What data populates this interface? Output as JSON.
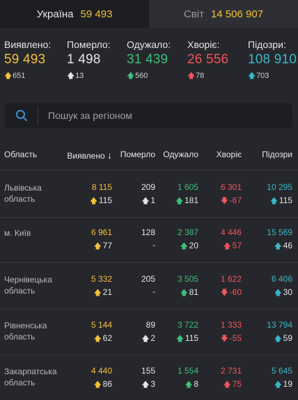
{
  "colors": {
    "confirmed": "#f3c13a",
    "deaths": "#ffffff",
    "recovered": "#3fbf7a",
    "sick": "#f0555d",
    "suspected": "#3ab8c8"
  },
  "tabs": [
    {
      "label": "Україна",
      "count": "59 493"
    },
    {
      "label": "Світ",
      "count": "14 506 907"
    }
  ],
  "summary": {
    "confirmed": {
      "label": "Виявлено:",
      "value": "59 493",
      "delta": "651"
    },
    "deaths": {
      "label": "Померло:",
      "value": "1 498",
      "delta": "13"
    },
    "recovered": {
      "label": "Одужало:",
      "value": "31 439",
      "delta": "560"
    },
    "sick": {
      "label": "Хворіє:",
      "value": "26 556",
      "delta": "78"
    },
    "suspected": {
      "label": "Підозри:",
      "value": "108 910",
      "delta": "703"
    }
  },
  "search": {
    "placeholder": "Пошук за регіоном",
    "icon": "search-icon"
  },
  "table": {
    "headers": {
      "region": "Область",
      "confirmed": "Виявлено",
      "deaths": "Померло",
      "recovered": "Одужало",
      "sick": "Хворіє",
      "suspected": "Підозри"
    },
    "sort_indicator": "↓",
    "rows": [
      {
        "region": "Львівська область",
        "confirmed": "8 115",
        "confirmed_delta": "115",
        "deaths": "209",
        "deaths_delta": "1",
        "recovered": "1 605",
        "recovered_delta": "181",
        "sick": "6 301",
        "sick_delta": "-67",
        "suspected": "10 295",
        "suspected_delta": "115"
      },
      {
        "region": "м. Київ",
        "confirmed": "6 961",
        "confirmed_delta": "77",
        "deaths": "128",
        "deaths_delta": "-",
        "recovered": "2 387",
        "recovered_delta": "20",
        "sick": "4 446",
        "sick_delta": "57",
        "suspected": "15 569",
        "suspected_delta": "46"
      },
      {
        "region": "Чернівецька область",
        "confirmed": "5 332",
        "confirmed_delta": "21",
        "deaths": "205",
        "deaths_delta": "-",
        "recovered": "3 505",
        "recovered_delta": "81",
        "sick": "1 622",
        "sick_delta": "-60",
        "suspected": "6 406",
        "suspected_delta": "30"
      },
      {
        "region": "Рівненська область",
        "confirmed": "5 144",
        "confirmed_delta": "62",
        "deaths": "89",
        "deaths_delta": "2",
        "recovered": "3 722",
        "recovered_delta": "115",
        "sick": "1 333",
        "sick_delta": "-55",
        "suspected": "13 794",
        "suspected_delta": "59"
      },
      {
        "region": "Закарпатська область",
        "confirmed": "4 440",
        "confirmed_delta": "86",
        "deaths": "155",
        "deaths_delta": "3",
        "recovered": "1 554",
        "recovered_delta": "8",
        "sick": "2 731",
        "sick_delta": "75",
        "suspected": "5 645",
        "suspected_delta": "19"
      }
    ]
  }
}
